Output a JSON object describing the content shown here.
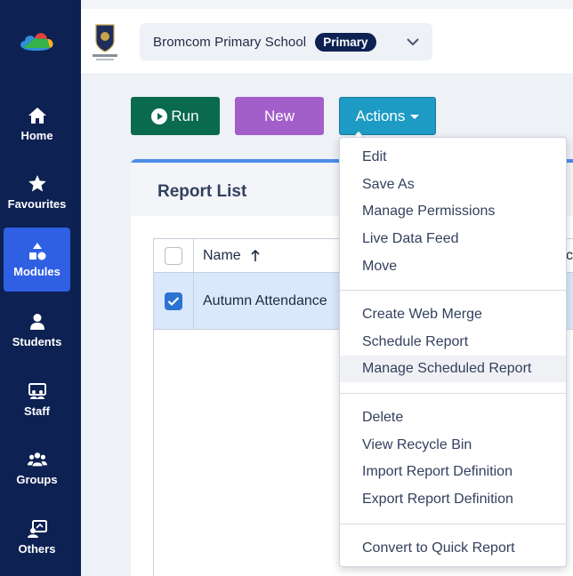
{
  "sidebar": {
    "items": [
      {
        "label": "Home",
        "icon": "home-icon"
      },
      {
        "label": "Favourites",
        "icon": "star-icon"
      },
      {
        "label": "Modules",
        "icon": "modules-icon",
        "active": true
      },
      {
        "label": "Students",
        "icon": "student-icon"
      },
      {
        "label": "Staff",
        "icon": "staff-icon"
      },
      {
        "label": "Groups",
        "icon": "groups-icon"
      },
      {
        "label": "Others",
        "icon": "others-icon"
      }
    ]
  },
  "header": {
    "school_name": "Bromcom Primary School",
    "school_type": "Primary"
  },
  "toolbar": {
    "run_label": "Run",
    "new_label": "New",
    "actions_label": "Actions"
  },
  "report_list": {
    "title": "Report List",
    "columns": [
      "Name",
      "c"
    ],
    "rows": [
      {
        "name": "Autumn Attendance",
        "checked": true
      }
    ]
  },
  "actions_menu": {
    "group1": [
      "Edit",
      "Save As",
      "Manage Permissions",
      "Live Data Feed",
      "Move"
    ],
    "group2": [
      "Create Web Merge",
      "Schedule Report",
      "Manage Scheduled Report"
    ],
    "group3": [
      "Delete",
      "View Recycle Bin",
      "Import Report Definition",
      "Export Report Definition"
    ],
    "group4": [
      "Convert to Quick Report"
    ],
    "hovered": "Manage Scheduled Report"
  },
  "colors": {
    "sidebar_bg": "#0d2152",
    "active_nav": "#2f5fe3",
    "run_button": "#0a6a4d",
    "new_button": "#a25fc9",
    "actions_button": "#1e9bc4",
    "selected_row": "#d9e8fb"
  }
}
